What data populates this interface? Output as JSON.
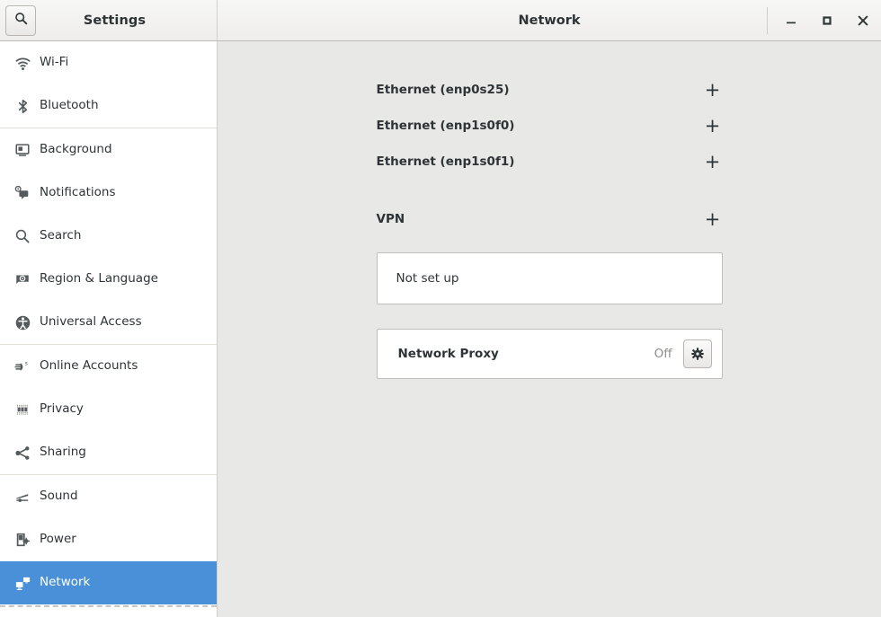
{
  "titlebar": {
    "app_title": "Settings",
    "panel_title": "Network",
    "search_icon": "search-icon",
    "minimize_label": "–",
    "maximize_label": "□",
    "close_label": "✕"
  },
  "sidebar": {
    "groups": [
      {
        "items": [
          {
            "label": "Wi-Fi",
            "icon": "wifi-icon",
            "selected": false
          },
          {
            "label": "Bluetooth",
            "icon": "bluetooth-icon",
            "selected": false
          }
        ]
      },
      {
        "items": [
          {
            "label": "Background",
            "icon": "background-icon",
            "selected": false
          },
          {
            "label": "Notifications",
            "icon": "notifications-icon",
            "selected": false
          },
          {
            "label": "Search",
            "icon": "search-icon",
            "selected": false
          },
          {
            "label": "Region & Language",
            "icon": "region-language-icon",
            "selected": false
          },
          {
            "label": "Universal Access",
            "icon": "universal-access-icon",
            "selected": false
          }
        ]
      },
      {
        "items": [
          {
            "label": "Online Accounts",
            "icon": "online-accounts-icon",
            "selected": false
          },
          {
            "label": "Privacy",
            "icon": "privacy-icon",
            "selected": false
          },
          {
            "label": "Sharing",
            "icon": "sharing-icon",
            "selected": false
          }
        ]
      },
      {
        "items": [
          {
            "label": "Sound",
            "icon": "sound-icon",
            "selected": false
          },
          {
            "label": "Power",
            "icon": "power-icon",
            "selected": false
          },
          {
            "label": "Network",
            "icon": "network-icon",
            "selected": true
          }
        ]
      }
    ]
  },
  "main": {
    "devices": [
      {
        "name": "Ethernet (enp0s25)",
        "add_label": "+"
      },
      {
        "name": "Ethernet (enp1s0f0)",
        "add_label": "+"
      },
      {
        "name": "Ethernet (enp1s0f1)",
        "add_label": "+"
      }
    ],
    "vpn": {
      "title": "VPN",
      "add_label": "+",
      "status": "Not set up"
    },
    "proxy": {
      "label": "Network Proxy",
      "state": "Off",
      "settings_icon": "gear-icon"
    }
  },
  "colors": {
    "selection": "#4a90d9",
    "content_bg": "#e8e8e7",
    "sidebar_bg": "#ffffff",
    "text": "#2e3436",
    "muted_text": "#8d8d8a"
  }
}
